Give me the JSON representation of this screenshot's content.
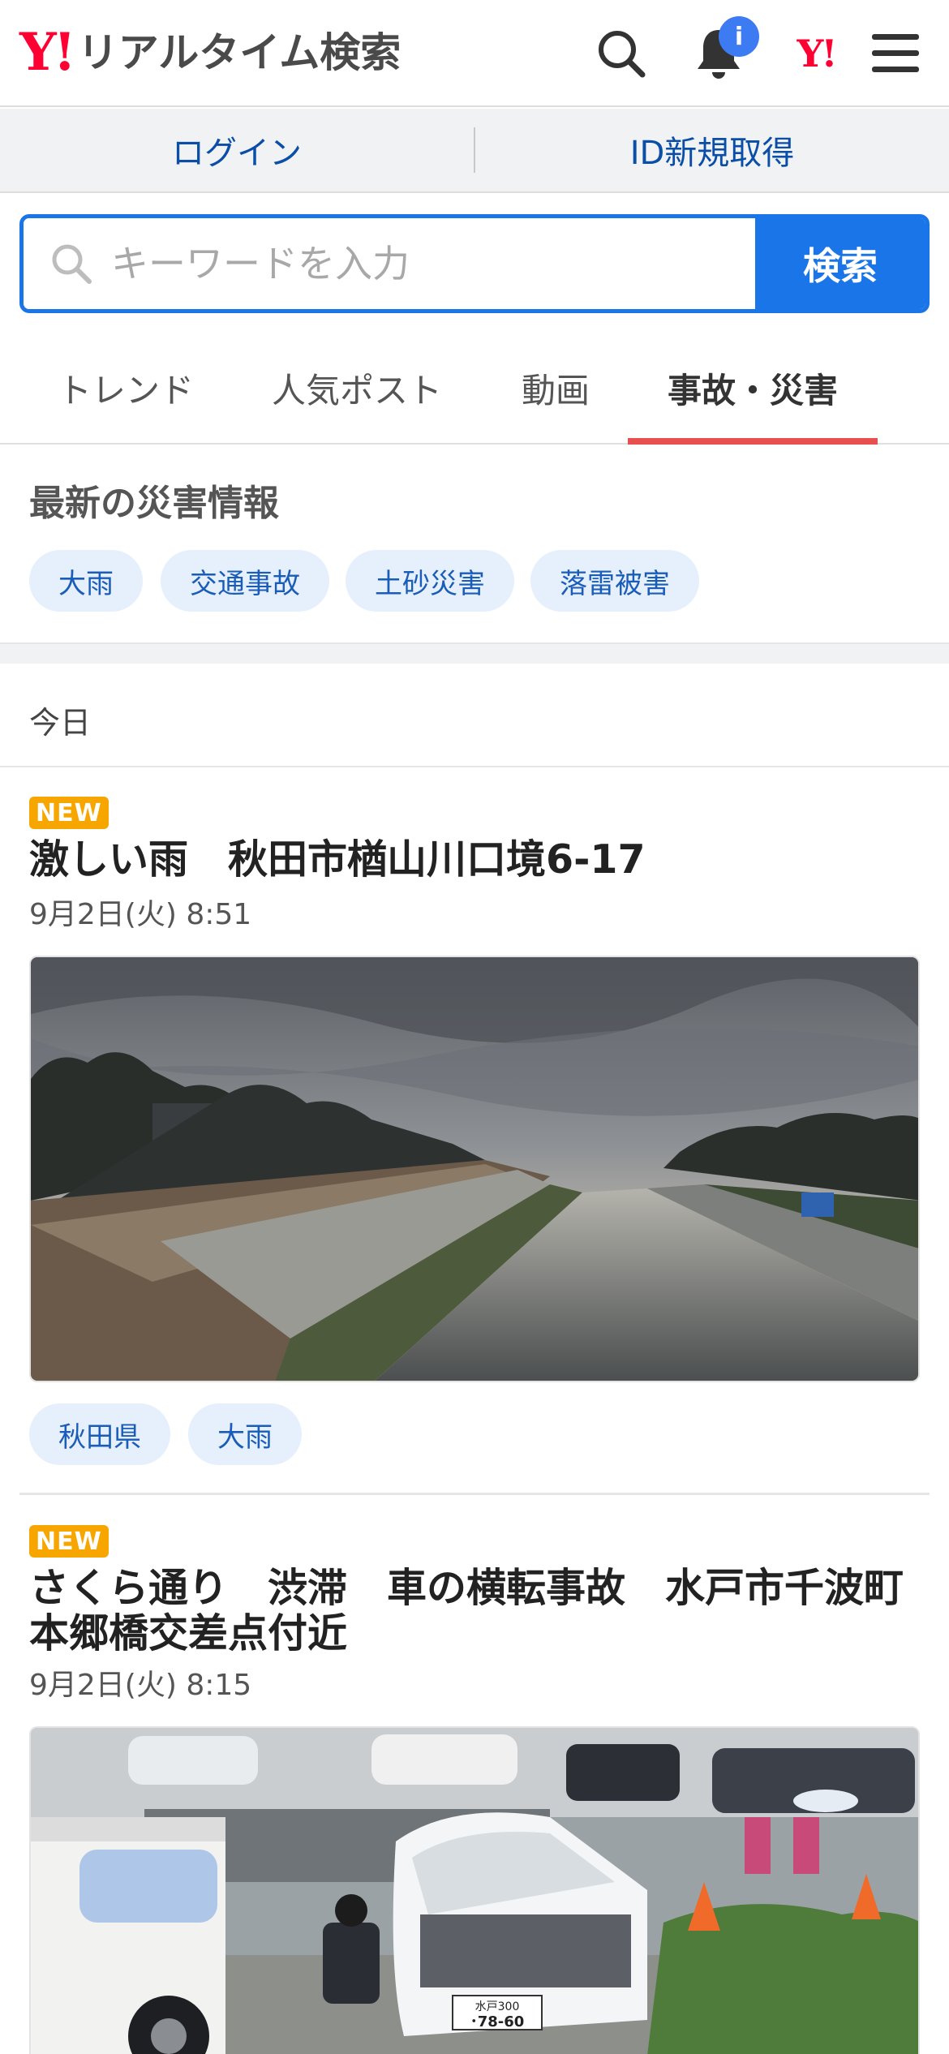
{
  "header": {
    "logo_mark": "Y!",
    "logo_text": "リアルタイム検索",
    "notification_badge": "i",
    "yj_mark": "Y!",
    "icons": [
      "search-icon",
      "bell-icon",
      "yahoo-icon",
      "menu-icon"
    ]
  },
  "loginbar": {
    "login": "ログイン",
    "register": "ID新規取得"
  },
  "search": {
    "placeholder": "キーワードを入力",
    "button": "検索"
  },
  "tabs": [
    {
      "label": "トレンド"
    },
    {
      "label": "人気ポスト"
    },
    {
      "label": "動画"
    },
    {
      "label": "事故・災害",
      "active": true
    }
  ],
  "disaster": {
    "title": "最新の災害情報",
    "chips": [
      "大雨",
      "交通事故",
      "土砂災害",
      "落雷被害"
    ]
  },
  "day_label": "今日",
  "posts": [
    {
      "badge": "NEW",
      "title": "激しい雨　秋田市楢山川口境6-17",
      "date": "9月2日(火) 8:51",
      "tags": [
        "秋田県",
        "大雨"
      ]
    },
    {
      "badge": "NEW",
      "title": "さくら通り　渋滞　車の横転事故　水戸市千波町本郷橋交差点付近",
      "date": "9月2日(火) 8:15",
      "plates": [
        "水戸300",
        "･78-60"
      ]
    }
  ],
  "colors": {
    "accent_blue": "#1a75e8",
    "brand_red": "#ff0033",
    "tab_underline": "#e85050",
    "new_badge": "#f7a600",
    "chip_bg": "#e6effc",
    "chip_text": "#1a5db8"
  }
}
